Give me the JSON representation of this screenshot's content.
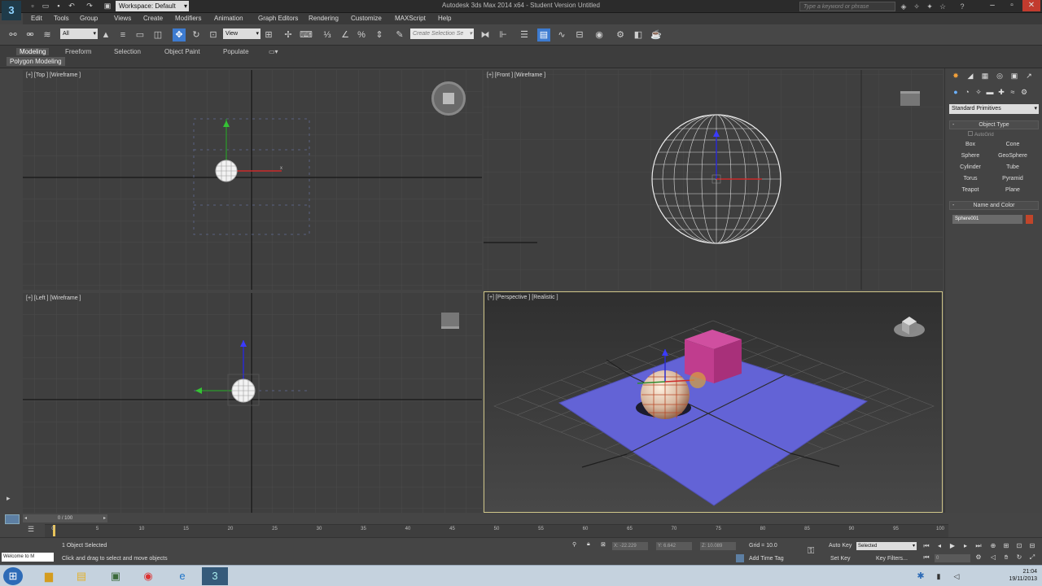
{
  "titlebar": {
    "workspace_label": "Workspace: Default",
    "window_title": "Autodesk 3ds Max 2014 x64 - Student Version   Untitled",
    "search_placeholder": "Type a keyword or phrase"
  },
  "menu": [
    "Edit",
    "Tools",
    "Group",
    "Views",
    "Create",
    "Modifiers",
    "Animation",
    "Graph Editors",
    "Rendering",
    "Customize",
    "MAXScript",
    "Help"
  ],
  "toolbar": {
    "filter_value": "All",
    "refcoord_value": "View",
    "selection_set_placeholder": "Create Selection Se"
  },
  "ribbon": {
    "tabs": [
      "Modeling",
      "Freeform",
      "Selection",
      "Object Paint",
      "Populate"
    ],
    "panel_label": "Polygon Modeling"
  },
  "viewports": {
    "top": {
      "label": "[+] [Top ] [Wireframe ]"
    },
    "front": {
      "label": "[+] [Front ] [Wireframe ]"
    },
    "left": {
      "label": "[+] [Left ] [Wireframe ]"
    },
    "perspective": {
      "label": "[+] [Perspective ] [Realistic ]"
    }
  },
  "command_panel": {
    "category": "Standard Primitives",
    "object_type_title": "Object Type",
    "autogrid": "AutoGrid",
    "primitives": [
      "Box",
      "Cone",
      "Sphere",
      "GeoSphere",
      "Cylinder",
      "Tube",
      "Torus",
      "Pyramid",
      "Teapot",
      "Plane"
    ],
    "name_color_title": "Name and Color",
    "object_name": "Sphere001",
    "object_color": "#c1452a"
  },
  "timeline": {
    "frame_counter": "0 / 100",
    "ticks": [
      "0",
      "5",
      "10",
      "15",
      "20",
      "25",
      "30",
      "35",
      "40",
      "45",
      "50",
      "55",
      "60",
      "65",
      "70",
      "75",
      "80",
      "85",
      "90",
      "95",
      "100"
    ]
  },
  "status": {
    "welcome": "Welcome to M",
    "selection_info": "1 Object Selected",
    "prompt": "Click and drag to select and move objects",
    "x_value": "X: -22.229",
    "y_value": "Y: 6.642",
    "z_value": "Z: 10.089",
    "grid": "Grid = 10.0",
    "auto_key": "Auto Key",
    "set_key": "Set Key",
    "key_mode": "Selected",
    "key_filters": "Key Filters...",
    "add_time_tag": "Add Time Tag",
    "current_frame": "0"
  },
  "taskbar": {
    "time": "21:04",
    "date": "19/11/2013"
  }
}
